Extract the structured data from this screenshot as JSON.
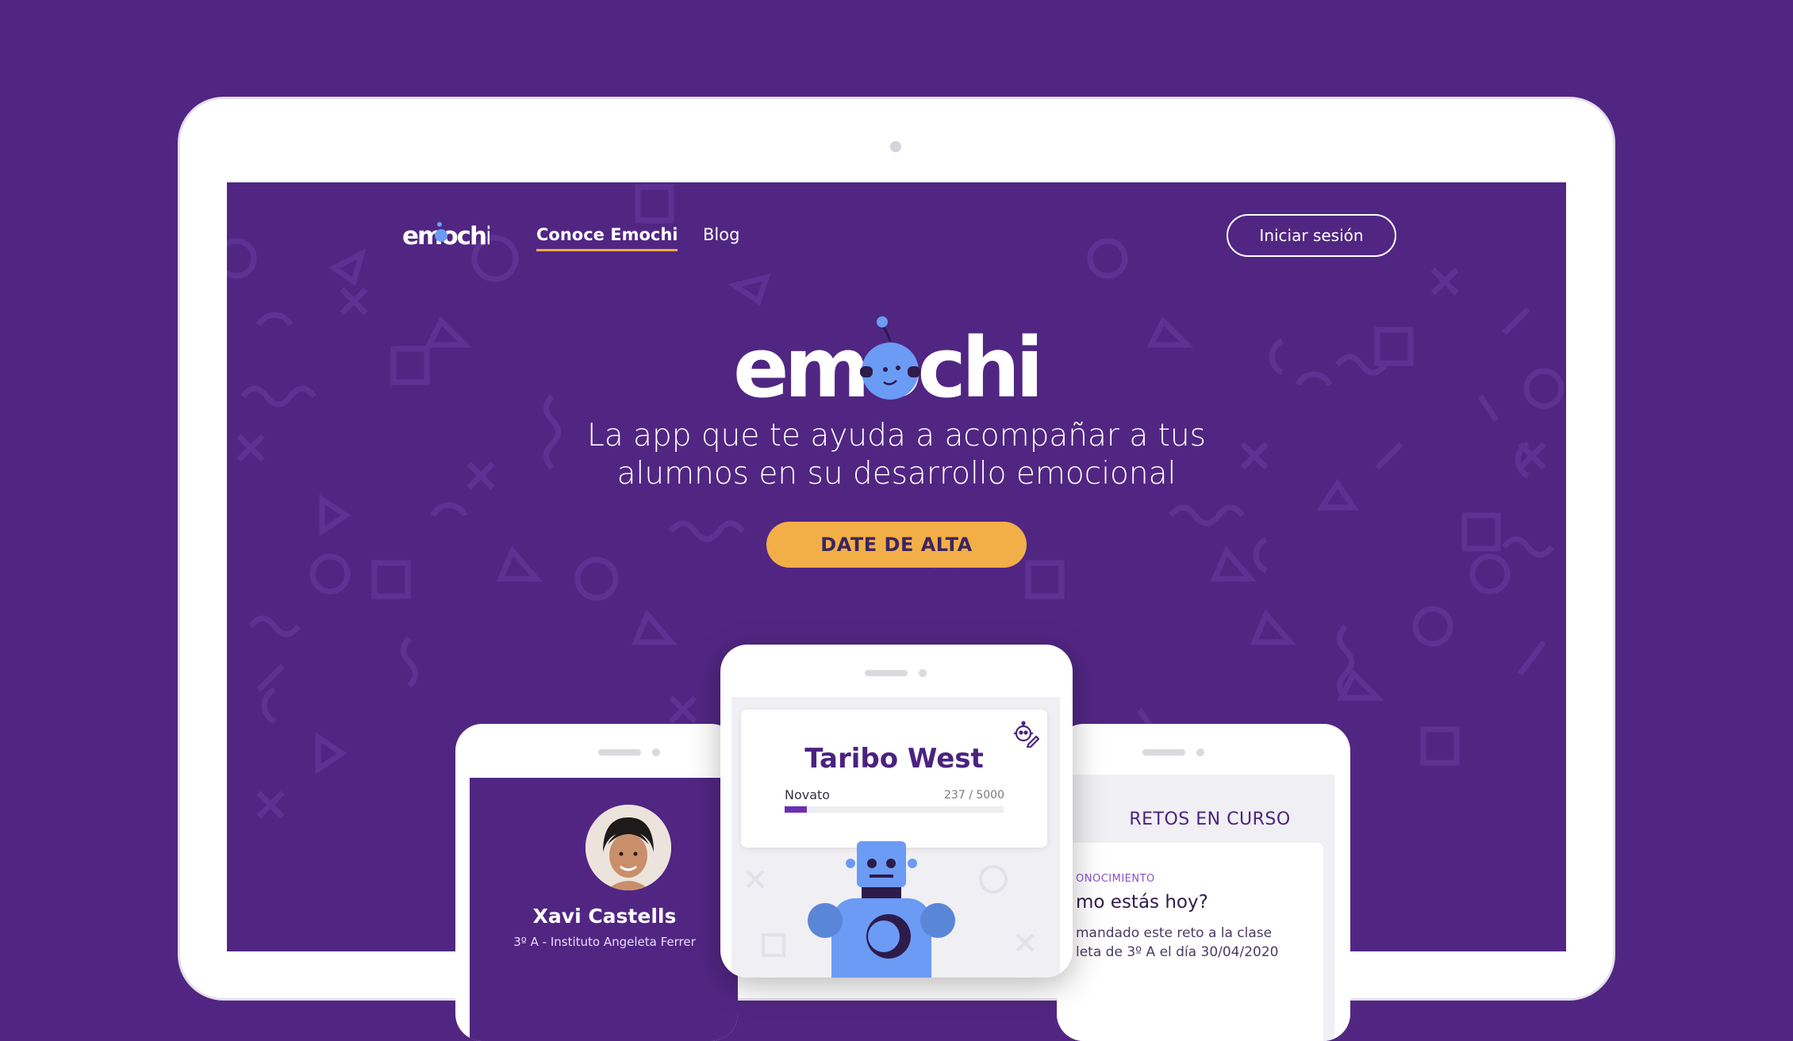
{
  "nav": {
    "logo_text": "emochi",
    "links": [
      {
        "label": "Conoce Emochi",
        "active": true
      },
      {
        "label": "Blog",
        "active": false
      }
    ],
    "login_label": "Iniciar sesión"
  },
  "hero": {
    "logo_text": "emochi",
    "tagline_line1": "La app que te ayuda a acompañar a tus",
    "tagline_line2": "alumnos en su desarrollo emocional",
    "cta_label": "DATE DE ALTA"
  },
  "student_card": {
    "name": "Xavi Castells",
    "class_info": "3º A - Instituto Angeleta Ferrer"
  },
  "profile_card": {
    "name": "Taribo West",
    "level": "Novato",
    "points_text": "237 / 5000",
    "progress": 0.0474
  },
  "challenges": {
    "title": "RETOS EN CURSO",
    "category": "ONOCIMIENTO",
    "question": "mo estás hoy?",
    "desc_line1": "mandado este reto a la clase",
    "desc_line2": "leta de 3º A el día 30/04/2020"
  },
  "colors": {
    "background": "#512683",
    "accent": "#f2ae47",
    "robot_blue": "#6b9bf5",
    "primary_text": "#4a2380"
  },
  "icons": {
    "edit_profile": "robot-edit-icon"
  }
}
